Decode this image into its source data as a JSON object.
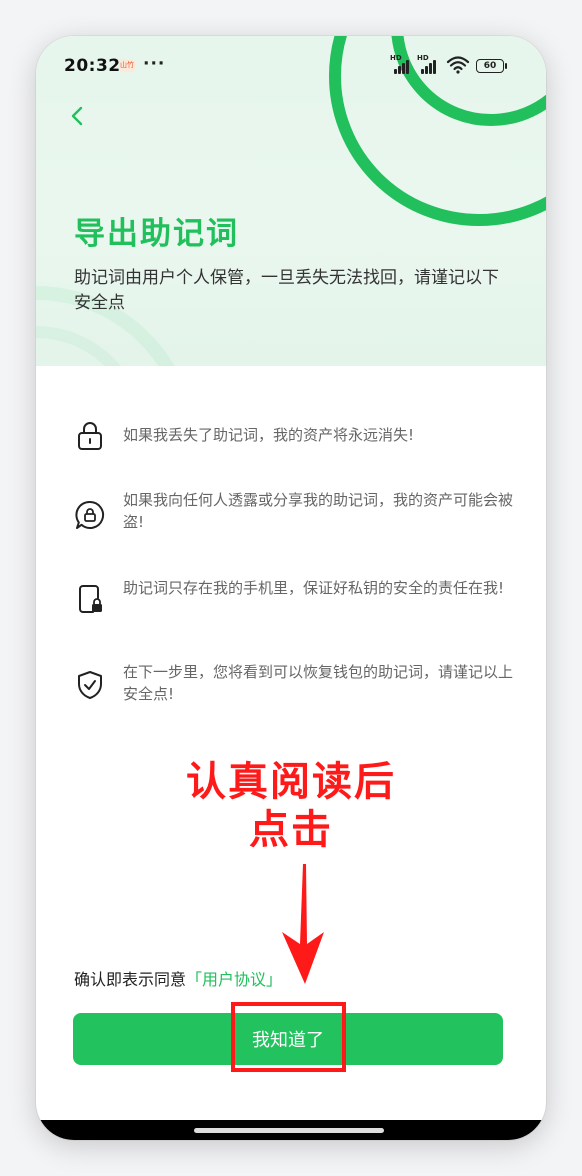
{
  "status_bar": {
    "time": "20:32",
    "app_badge": "山竹",
    "more": "···",
    "signal_label_1": "HD",
    "signal_label_2": "HD",
    "battery": "60"
  },
  "header": {
    "title": "导出助记词",
    "subtitle": "助记词由用户个人保管，一旦丢失无法找回，请谨记以下安全点"
  },
  "tips": [
    {
      "icon": "lock-icon",
      "text": "如果我丢失了助记词，我的资产将永远消失!"
    },
    {
      "icon": "chat-lock-icon",
      "text": "如果我向任何人透露或分享我的助记词，我的资产可能会被盗!"
    },
    {
      "icon": "phone-lock-icon",
      "text": "助记词只存在我的手机里，保证好私钥的安全的责任在我!"
    },
    {
      "icon": "shield-check-icon",
      "text": "在下一步里，您将看到可以恢复钱包的助记词，请谨记以上安全点!"
    }
  ],
  "annotation": {
    "line1": "认真阅读后",
    "line2": "点击"
  },
  "consent": {
    "prefix": "确认即表示同意",
    "link": "「用户协议」"
  },
  "confirm_button": "我知道了",
  "colors": {
    "accent": "#21c05c",
    "annotation": "#ff1a1a"
  }
}
